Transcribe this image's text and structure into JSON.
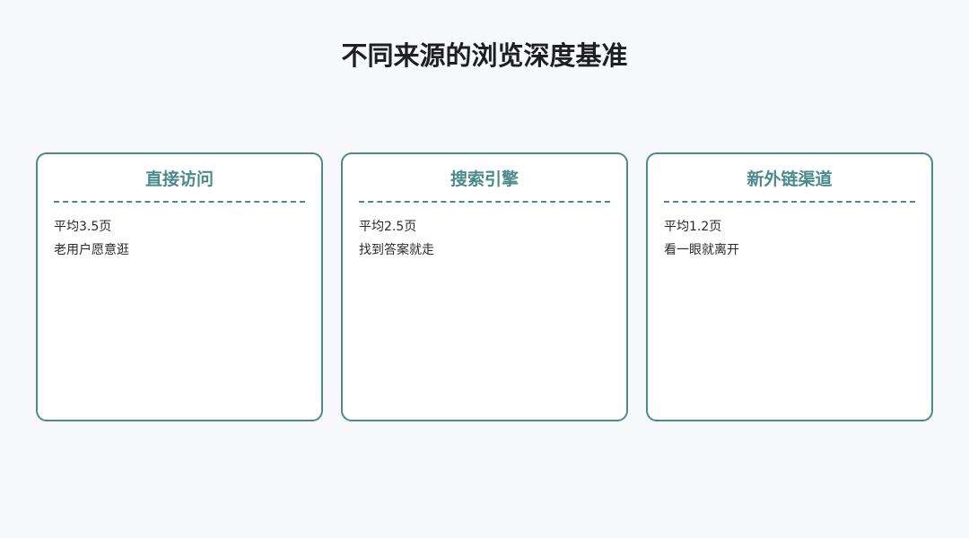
{
  "title": "不同来源的浏览深度基准",
  "cards": [
    {
      "title": "直接访问",
      "lines": [
        "平均3.5页",
        "老用户愿意逛"
      ]
    },
    {
      "title": "搜索引擎",
      "lines": [
        "平均2.5页",
        "找到答案就走"
      ]
    },
    {
      "title": "新外链渠道",
      "lines": [
        "平均1.2页",
        "看一眼就离开"
      ]
    }
  ],
  "colors": {
    "accent": "#4a8a8c",
    "background": "#f7f9fc"
  }
}
